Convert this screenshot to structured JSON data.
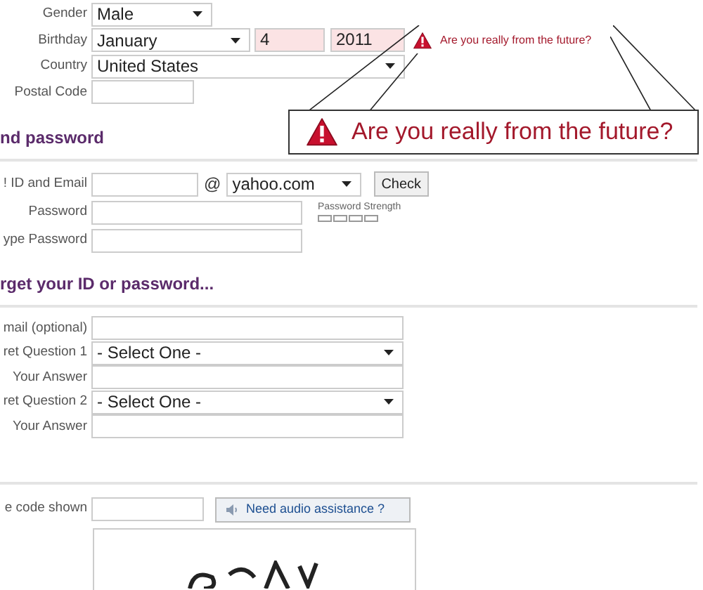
{
  "gender": {
    "label": "Gender",
    "value": "Male"
  },
  "birthday": {
    "label": "Birthday",
    "month": "January",
    "day": "4",
    "year": "2011",
    "invalid": true
  },
  "country": {
    "label": "Country",
    "value": "United States"
  },
  "postal_code": {
    "label": "Postal Code"
  },
  "error": {
    "message": "Are you really from the future?"
  },
  "zoomed_error": {
    "message": "Are you really from the future?"
  },
  "id_section": {
    "title": "nd password",
    "id_label": "! ID and Email",
    "at": "@",
    "domain": "yahoo.com",
    "check_button": "Check",
    "password_label": "Password",
    "strength_label": "Password Strength",
    "retype_label": "ype Password"
  },
  "recovery_section": {
    "title": "rget your ID or password...",
    "rows": [
      {
        "label": "mail (optional)",
        "kind": "text"
      },
      {
        "label": "ret Question 1",
        "kind": "select",
        "value": "- Select One -"
      },
      {
        "label": "Your Answer",
        "kind": "text"
      },
      {
        "label": "ret Question 2",
        "kind": "select",
        "value": "- Select One -"
      },
      {
        "label": "Your Answer",
        "kind": "text"
      }
    ]
  },
  "captcha": {
    "label": "e code shown",
    "audio_button": "Need audio assistance ?"
  }
}
